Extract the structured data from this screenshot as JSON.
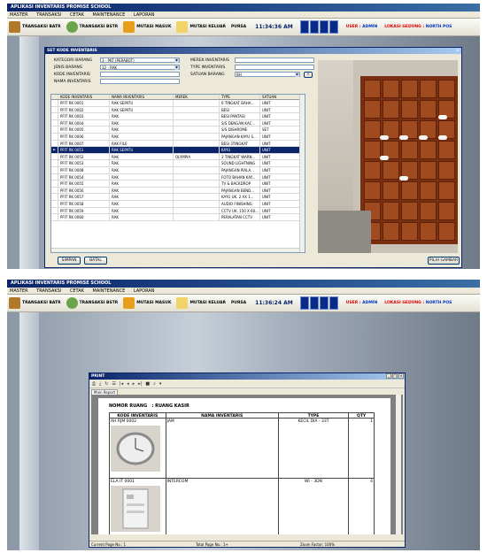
{
  "top": {
    "app_title": "APLIKASI INVENTARIS PROMISE SCHOOL",
    "menu": [
      "MASTER",
      "TRANSAKSI",
      "CETAK",
      "MAINTENANCE",
      "LAPORAN"
    ],
    "toolbar": {
      "t1": "TRANSAKSI BATR",
      "t2": "TRANSAKSI BSTR",
      "t3": "MUTASI MASUK",
      "t4": "MUTASI KELUAR",
      "t5": "PURSA",
      "time": "11:34:36 AM",
      "user_label": "USER :",
      "user_value": "ADMIN",
      "lokasi_label": "LOKASI GEDUNG :",
      "lokasi_value": "NORTH POS"
    },
    "window_title": "SET KODE INVENTARIS",
    "form": {
      "kategori_label": "KATEGORI BARANG",
      "kategori_value": "3 - PKT (PERABOT)",
      "jenis_label": "JENIS BARANG",
      "jenis_value": "32 - RAK",
      "kode_label": "KODE INVENTARIS",
      "nama_label": "NAMA INVENTARIS",
      "merek_label": "MEREK INVENTARIS",
      "type_label": "TYPE INVENTARIS",
      "satuan_label": "SATUAN BARANG",
      "satuan_value": "BH",
      "plus": "+"
    },
    "grid": {
      "headers": [
        "KODE INVENTARIS",
        "NAMA INVENTARIS",
        "MEREK",
        "TYPE",
        "SATUAN"
      ],
      "rows": [
        [
          "PFIT RK 0001",
          "RAK SEPATU",
          "",
          "6 TINGKAT BAHA...",
          "UNIT"
        ],
        [
          "PFIT RK 0002",
          "RAK SEPATU",
          "",
          "BESI",
          "UNIT"
        ],
        [
          "PFIT RK 0003",
          "RAK",
          "",
          "BESI PANTASI",
          "UNIT"
        ],
        [
          "PFIT RK 0004",
          "RAK",
          "",
          "S/S DENGAN KAC...",
          "UNIT"
        ],
        [
          "PFIT RK 0005",
          "RAK",
          "",
          "S/S DISHROME",
          "SET"
        ],
        [
          "PFIT RK 0006",
          "RAK",
          "",
          "PAJANGAN KAYU S...",
          "UNIT"
        ],
        [
          "PFIT RK 0007",
          "RAK FILE",
          "",
          "BESI 3TINGKAT",
          "UNIT"
        ],
        [
          "PFIT RK 0051",
          "RAK SEPATU",
          "",
          "KAYU",
          "UNIT"
        ],
        [
          "PFIT RK 0052",
          "RAK",
          "OLYMPIA",
          "3 TINGKAT WARN...",
          "UNIT"
        ],
        [
          "PFIT RK 0053",
          "RAK",
          "",
          "SOUND LIGHTNING",
          "UNIT"
        ],
        [
          "PFIT RK 0008",
          "RAK",
          "",
          "PAJANGAN PIALA...",
          "UNIT"
        ],
        [
          "PFIT RK 0054",
          "RAK",
          "",
          "FOTO BAHAN KAY...",
          "UNIT"
        ],
        [
          "PFIT RK 0055",
          "RAK",
          "",
          "TV & BACKDROP",
          "UNIT"
        ],
        [
          "PFIT RK 0056",
          "RAK",
          "",
          "PAJANGAN BEND...",
          "UNIT"
        ],
        [
          "PFIT RK 0057",
          "RAK",
          "",
          "KAYU UK. 2 AX 1...",
          "UNIT"
        ],
        [
          "PFIT RK 0058",
          "RAK",
          "",
          "AUDIO FINISHING",
          "UNIT"
        ],
        [
          "PFIT RK 0059",
          "RAK",
          "",
          "CCTV UK. 150 X 60...",
          "UNIT"
        ],
        [
          "PFIT RK 0060",
          "RAK",
          "",
          "PERALATAN CCTV",
          "UNIT"
        ]
      ],
      "selected_index": 7
    },
    "buttons": {
      "simpan": "SIMPAN",
      "batal": "BATAL",
      "pilih": "PILIH GAMBAR"
    }
  },
  "bottom": {
    "app_title": "APLIKASI INVENTARIS PROMISE SCHOOL",
    "menu": [
      "MASTER",
      "TRANSAKSI",
      "CETAK",
      "MAINTENANCE",
      "LAPORAN"
    ],
    "toolbar": {
      "t1": "TRANSAKSI BATR",
      "t2": "TRANSAKSI BSTR",
      "t3": "MUTASI MASUK",
      "t4": "MUTASI KELUAR",
      "t5": "PURSA",
      "time": "11:36:24 AM",
      "user_label": "USER :",
      "user_value": "ADMIN",
      "lokasi_label": "LOKASI GEDUNG :",
      "lokasi_value": "NORTH POS"
    },
    "print_title": "PRINT",
    "tab": "Main Report",
    "report": {
      "nomor_label": "NOMOR RUANG",
      "nomor_value": ": RUANG KASIR",
      "headers": [
        "KODE INVENTARIS",
        "NAMA INVENTARIS",
        "TYPE",
        "QTY"
      ],
      "rows": [
        {
          "kode": "AH RJM 0002",
          "nama": "JAM",
          "type": "KECIL DIA - 33T",
          "qty": "1"
        },
        {
          "kode": "ELA IT 0001",
          "nama": "INTERCOM",
          "type": "WI - 3DN",
          "qty": "4"
        }
      ]
    },
    "status": {
      "current": "Current Page No.: 1",
      "total": "Total Page No.: 1+",
      "zoom": "Zoom Factor: 100%"
    }
  }
}
